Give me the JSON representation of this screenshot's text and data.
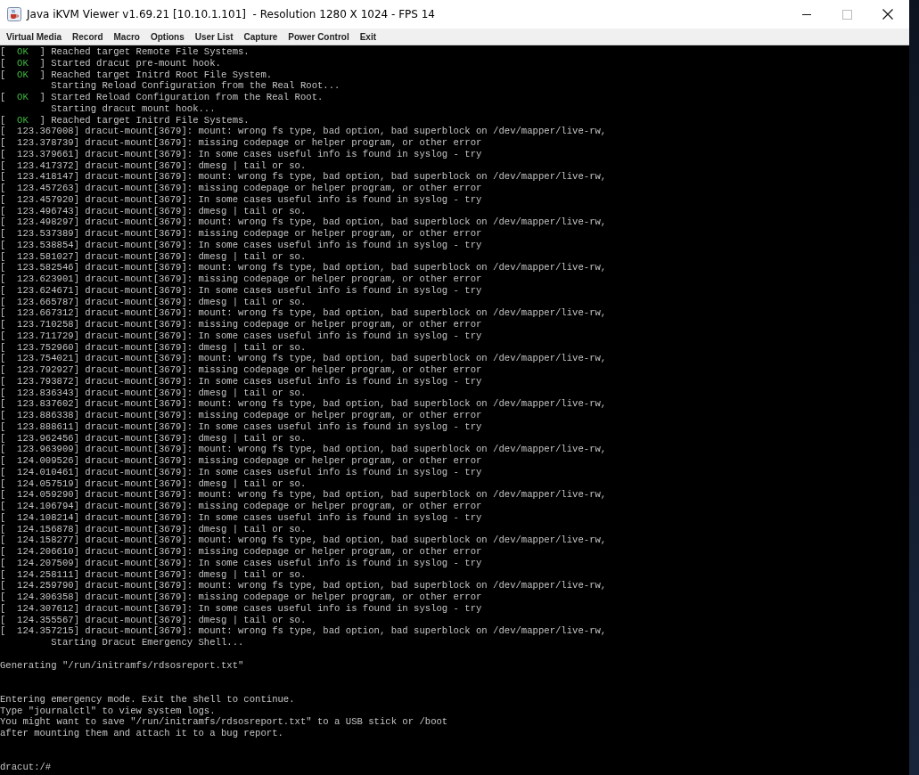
{
  "window": {
    "title": "Java iKVM Viewer v1.69.21 [10.10.1.101]  - Resolution 1280 X 1024 - FPS 14"
  },
  "menu": [
    "Virtual Media",
    "Record",
    "Macro",
    "Options",
    "User List",
    "Capture",
    "Power Control",
    "Exit"
  ],
  "console": {
    "lines": [
      {
        "kind": "ok",
        "lead": "[",
        "status": "OK",
        "text": "] Reached target Remote File Systems."
      },
      {
        "kind": "ok",
        "lead": "[",
        "status": "OK",
        "text": "] Started dracut pre-mount hook."
      },
      {
        "kind": "ok",
        "lead": "[",
        "status": "OK",
        "text": "] Reached target Initrd Root File System."
      },
      {
        "kind": "indented",
        "text": "Starting Reload Configuration from the Real Root..."
      },
      {
        "kind": "ok",
        "lead": "[",
        "status": "OK",
        "text": "] Started Reload Configuration from the Real Root."
      },
      {
        "kind": "indented",
        "text": "Starting dracut mount hook..."
      },
      {
        "kind": "ok",
        "lead": "[",
        "status": "OK",
        "text": "] Reached target Initrd File Systems."
      },
      {
        "kind": "log",
        "text": "[  123.367008] dracut-mount[3679]: mount: wrong fs type, bad option, bad superblock on /dev/mapper/live-rw,"
      },
      {
        "kind": "log",
        "text": "[  123.378739] dracut-mount[3679]: missing codepage or helper program, or other error"
      },
      {
        "kind": "log",
        "text": "[  123.379661] dracut-mount[3679]: In some cases useful info is found in syslog - try"
      },
      {
        "kind": "log",
        "text": "[  123.417372] dracut-mount[3679]: dmesg | tail or so."
      },
      {
        "kind": "log",
        "text": "[  123.418147] dracut-mount[3679]: mount: wrong fs type, bad option, bad superblock on /dev/mapper/live-rw,"
      },
      {
        "kind": "log",
        "text": "[  123.457263] dracut-mount[3679]: missing codepage or helper program, or other error"
      },
      {
        "kind": "log",
        "text": "[  123.457920] dracut-mount[3679]: In some cases useful info is found in syslog - try"
      },
      {
        "kind": "log",
        "text": "[  123.496743] dracut-mount[3679]: dmesg | tail or so."
      },
      {
        "kind": "log",
        "text": "[  123.498297] dracut-mount[3679]: mount: wrong fs type, bad option, bad superblock on /dev/mapper/live-rw,"
      },
      {
        "kind": "log",
        "text": "[  123.537389] dracut-mount[3679]: missing codepage or helper program, or other error"
      },
      {
        "kind": "log",
        "text": "[  123.538854] dracut-mount[3679]: In some cases useful info is found in syslog - try"
      },
      {
        "kind": "log",
        "text": "[  123.581027] dracut-mount[3679]: dmesg | tail or so."
      },
      {
        "kind": "log",
        "text": "[  123.582546] dracut-mount[3679]: mount: wrong fs type, bad option, bad superblock on /dev/mapper/live-rw,"
      },
      {
        "kind": "log",
        "text": "[  123.623901] dracut-mount[3679]: missing codepage or helper program, or other error"
      },
      {
        "kind": "log",
        "text": "[  123.624671] dracut-mount[3679]: In some cases useful info is found in syslog - try"
      },
      {
        "kind": "log",
        "text": "[  123.665787] dracut-mount[3679]: dmesg | tail or so."
      },
      {
        "kind": "log",
        "text": "[  123.667312] dracut-mount[3679]: mount: wrong fs type, bad option, bad superblock on /dev/mapper/live-rw,"
      },
      {
        "kind": "log",
        "text": "[  123.710258] dracut-mount[3679]: missing codepage or helper program, or other error"
      },
      {
        "kind": "log",
        "text": "[  123.711729] dracut-mount[3679]: In some cases useful info is found in syslog - try"
      },
      {
        "kind": "log",
        "text": "[  123.752960] dracut-mount[3679]: dmesg | tail or so."
      },
      {
        "kind": "log",
        "text": "[  123.754021] dracut-mount[3679]: mount: wrong fs type, bad option, bad superblock on /dev/mapper/live-rw,"
      },
      {
        "kind": "log",
        "text": "[  123.792927] dracut-mount[3679]: missing codepage or helper program, or other error"
      },
      {
        "kind": "log",
        "text": "[  123.793872] dracut-mount[3679]: In some cases useful info is found in syslog - try"
      },
      {
        "kind": "log",
        "text": "[  123.836343] dracut-mount[3679]: dmesg | tail or so."
      },
      {
        "kind": "log",
        "text": "[  123.837602] dracut-mount[3679]: mount: wrong fs type, bad option, bad superblock on /dev/mapper/live-rw,"
      },
      {
        "kind": "log",
        "text": "[  123.886338] dracut-mount[3679]: missing codepage or helper program, or other error"
      },
      {
        "kind": "log",
        "text": "[  123.888611] dracut-mount[3679]: In some cases useful info is found in syslog - try"
      },
      {
        "kind": "log",
        "text": "[  123.962456] dracut-mount[3679]: dmesg | tail or so."
      },
      {
        "kind": "log",
        "text": "[  123.963909] dracut-mount[3679]: mount: wrong fs type, bad option, bad superblock on /dev/mapper/live-rw,"
      },
      {
        "kind": "log",
        "text": "[  124.009526] dracut-mount[3679]: missing codepage or helper program, or other error"
      },
      {
        "kind": "log",
        "text": "[  124.010461] dracut-mount[3679]: In some cases useful info is found in syslog - try"
      },
      {
        "kind": "log",
        "text": "[  124.057519] dracut-mount[3679]: dmesg | tail or so."
      },
      {
        "kind": "log",
        "text": "[  124.059290] dracut-mount[3679]: mount: wrong fs type, bad option, bad superblock on /dev/mapper/live-rw,"
      },
      {
        "kind": "log",
        "text": "[  124.106794] dracut-mount[3679]: missing codepage or helper program, or other error"
      },
      {
        "kind": "log",
        "text": "[  124.108214] dracut-mount[3679]: In some cases useful info is found in syslog - try"
      },
      {
        "kind": "log",
        "text": "[  124.156878] dracut-mount[3679]: dmesg | tail or so."
      },
      {
        "kind": "log",
        "text": "[  124.158277] dracut-mount[3679]: mount: wrong fs type, bad option, bad superblock on /dev/mapper/live-rw,"
      },
      {
        "kind": "log",
        "text": "[  124.206610] dracut-mount[3679]: missing codepage or helper program, or other error"
      },
      {
        "kind": "log",
        "text": "[  124.207509] dracut-mount[3679]: In some cases useful info is found in syslog - try"
      },
      {
        "kind": "log",
        "text": "[  124.258111] dracut-mount[3679]: dmesg | tail or so."
      },
      {
        "kind": "log",
        "text": "[  124.259790] dracut-mount[3679]: mount: wrong fs type, bad option, bad superblock on /dev/mapper/live-rw,"
      },
      {
        "kind": "log",
        "text": "[  124.306358] dracut-mount[3679]: missing codepage or helper program, or other error"
      },
      {
        "kind": "log",
        "text": "[  124.307612] dracut-mount[3679]: In some cases useful info is found in syslog - try"
      },
      {
        "kind": "log",
        "text": "[  124.355567] dracut-mount[3679]: dmesg | tail or so."
      },
      {
        "kind": "log",
        "text": "[  124.357215] dracut-mount[3679]: mount: wrong fs type, bad option, bad superblock on /dev/mapper/live-rw,"
      },
      {
        "kind": "indented",
        "text": "Starting Dracut Emergency Shell..."
      },
      {
        "kind": "blank"
      },
      {
        "kind": "log",
        "text": "Generating \"/run/initramfs/rdsosreport.txt\""
      },
      {
        "kind": "blank"
      },
      {
        "kind": "blank"
      },
      {
        "kind": "log",
        "text": "Entering emergency mode. Exit the shell to continue."
      },
      {
        "kind": "log",
        "text": "Type \"journalctl\" to view system logs."
      },
      {
        "kind": "log",
        "text": "You might want to save \"/run/initramfs/rdsosreport.txt\" to a USB stick or /boot"
      },
      {
        "kind": "log",
        "text": "after mounting them and attach it to a bug report."
      },
      {
        "kind": "blank"
      },
      {
        "kind": "blank"
      },
      {
        "kind": "log",
        "text": "dracut:/#"
      }
    ]
  }
}
